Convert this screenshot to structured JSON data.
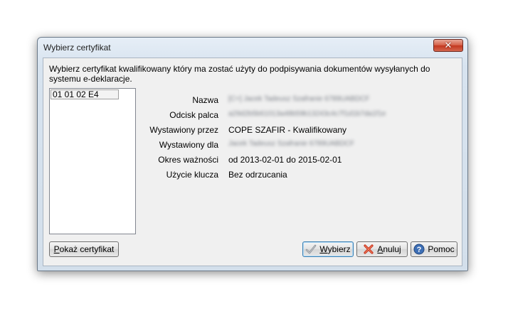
{
  "window": {
    "title": "Wybierz certyfikat",
    "close_glyph": "✕"
  },
  "description": "Wybierz certyfikat kwalifikowany który ma zostać użyty do podpisywania dokumentów wysyłanych do systemu e-deklaracje.",
  "certificates": [
    {
      "label": "01 01 02 E4"
    }
  ],
  "details": [
    {
      "label": "Nazwa",
      "value": "[C=] Jacek Tadeusz Szafranie 6789UABDCF",
      "obscured": true
    },
    {
      "label": "Odcisk palca",
      "value": "a29d2b5b61013a48b59b13243c4c7f1d1b7da1f1e",
      "obscured": true
    },
    {
      "label": "Wystawiony przez",
      "value": "COPE SZAFIR - Kwalifikowany",
      "obscured": false
    },
    {
      "label": "Wystawiony dla",
      "value": "Jacek Tadeusz Szafranie 6789UABDCF",
      "obscured": true
    },
    {
      "label": "Okres ważności",
      "value": "od 2013-02-01 do 2015-02-01",
      "obscured": false
    },
    {
      "label": "Użycie klucza",
      "value": "Bez odrzucania",
      "obscured": false
    }
  ],
  "buttons": {
    "show_cert": {
      "mnemonic": "P",
      "rest": "okaż certyfikat"
    },
    "select": {
      "mnemonic": "W",
      "rest": "ybierz",
      "icon": "check-icon"
    },
    "cancel": {
      "mnemonic": "A",
      "rest": "nuluj",
      "icon": "cancel-x-icon"
    },
    "help": {
      "label": "Pomoc",
      "icon": "help-icon"
    }
  }
}
